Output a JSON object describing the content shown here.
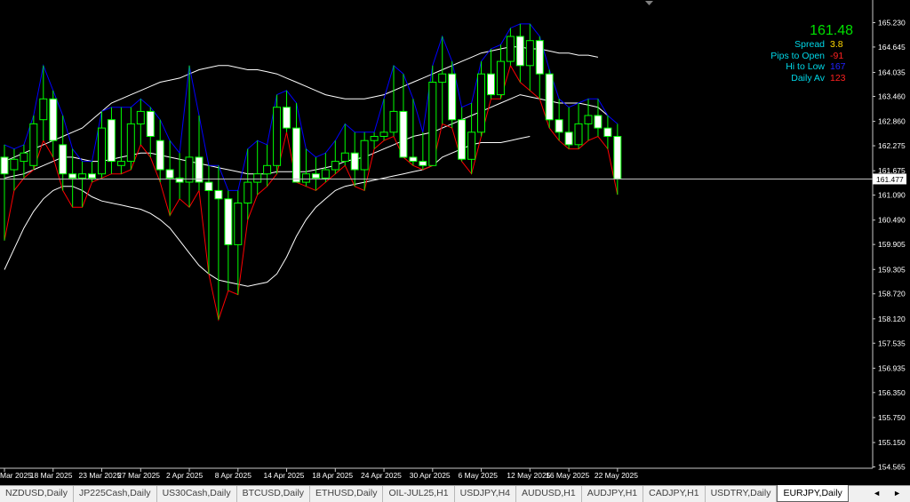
{
  "chart_data": {
    "type": "candlestick",
    "symbol": "EURJPY",
    "timeframe": "Daily",
    "price_axis": {
      "ticks": [
        "165.230",
        "164.645",
        "164.035",
        "163.460",
        "162.860",
        "162.275",
        "161.675",
        "161.090",
        "160.490",
        "159.905",
        "159.305",
        "158.720",
        "158.120",
        "157.535",
        "156.935",
        "156.350",
        "155.750",
        "155.150",
        "154.565"
      ],
      "range": [
        154.3,
        165.6
      ]
    },
    "current_price_label": "161.477",
    "current_price": 161.477,
    "date_labels": [
      "Mar 2025",
      "18 Mar 2025",
      "23 Mar 2025",
      "27 Mar 2025",
      "2 Apr 2025",
      "8 Apr 2025",
      "14 Apr 2025",
      "18 Apr 2025",
      "24 Apr 2025",
      "30 Apr 2025",
      "6 May 2025",
      "12 May 2025",
      "16 May 2025",
      "22 May 2025"
    ],
    "candles": [
      [
        162.0,
        162.3,
        160.0,
        161.6
      ],
      [
        161.7,
        162.2,
        161.2,
        161.95
      ],
      [
        161.9,
        162.3,
        161.5,
        162.1
      ],
      [
        161.8,
        163.0,
        161.7,
        162.8
      ],
      [
        162.9,
        164.2,
        162.4,
        163.4
      ],
      [
        163.4,
        163.6,
        162.0,
        162.4
      ],
      [
        162.3,
        163.0,
        161.2,
        161.6
      ],
      [
        161.6,
        162.2,
        160.8,
        161.5
      ],
      [
        161.5,
        161.9,
        160.8,
        161.6
      ],
      [
        161.6,
        161.9,
        161.4,
        161.5
      ],
      [
        161.6,
        163.1,
        161.5,
        162.7
      ],
      [
        162.9,
        163.2,
        161.6,
        161.9
      ],
      [
        161.8,
        163.2,
        161.6,
        161.9
      ],
      [
        161.9,
        163.2,
        161.7,
        162.8
      ],
      [
        162.8,
        163.4,
        162.3,
        163.1
      ],
      [
        163.1,
        163.2,
        162.0,
        162.5
      ],
      [
        162.4,
        162.9,
        161.4,
        161.7
      ],
      [
        161.7,
        162.4,
        160.6,
        161.5
      ],
      [
        161.5,
        162.1,
        161.0,
        161.4
      ],
      [
        161.4,
        164.2,
        160.8,
        162.0
      ],
      [
        162.0,
        163.0,
        161.2,
        161.4
      ],
      [
        161.4,
        161.8,
        159.2,
        161.2
      ],
      [
        161.2,
        161.8,
        158.1,
        161.0
      ],
      [
        161.0,
        161.2,
        158.8,
        159.9
      ],
      [
        159.9,
        161.2,
        158.7,
        160.9
      ],
      [
        160.9,
        162.2,
        160.5,
        161.4
      ],
      [
        161.4,
        162.4,
        161.1,
        161.6
      ],
      [
        161.6,
        162.3,
        161.3,
        161.8
      ],
      [
        161.8,
        163.5,
        161.6,
        163.2
      ],
      [
        163.2,
        163.6,
        162.6,
        162.7
      ],
      [
        162.7,
        163.3,
        161.4,
        161.4
      ],
      [
        161.4,
        162.2,
        161.3,
        161.6
      ],
      [
        161.6,
        162.0,
        161.2,
        161.5
      ],
      [
        161.5,
        162.1,
        161.4,
        161.7
      ],
      [
        161.7,
        162.4,
        161.6,
        161.9
      ],
      [
        161.9,
        162.8,
        161.8,
        162.1
      ],
      [
        162.1,
        162.6,
        161.3,
        161.7
      ],
      [
        161.7,
        162.6,
        161.2,
        162.4
      ],
      [
        162.4,
        162.6,
        162.2,
        162.5
      ],
      [
        162.5,
        163.4,
        162.4,
        162.6
      ],
      [
        162.6,
        164.2,
        162.5,
        163.1
      ],
      [
        163.1,
        164.0,
        162.0,
        162.0
      ],
      [
        162.0,
        163.4,
        161.8,
        161.9
      ],
      [
        161.9,
        162.6,
        161.7,
        161.8
      ],
      [
        161.8,
        164.2,
        161.8,
        163.8
      ],
      [
        163.8,
        164.9,
        162.8,
        164.0
      ],
      [
        164.0,
        164.3,
        162.7,
        162.9
      ],
      [
        162.9,
        163.2,
        161.9,
        161.95
      ],
      [
        161.95,
        163.3,
        161.6,
        162.6
      ],
      [
        162.6,
        164.3,
        162.5,
        164.0
      ],
      [
        164.0,
        164.6,
        163.4,
        163.5
      ],
      [
        163.5,
        164.7,
        163.4,
        164.3
      ],
      [
        164.3,
        165.1,
        164.2,
        164.9
      ],
      [
        164.9,
        165.2,
        163.8,
        164.2
      ],
      [
        164.2,
        165.2,
        163.6,
        164.8
      ],
      [
        164.8,
        164.9,
        163.4,
        164.0
      ],
      [
        164.0,
        164.1,
        162.7,
        162.9
      ],
      [
        162.9,
        163.4,
        162.4,
        162.6
      ],
      [
        162.6,
        163.2,
        162.2,
        162.3
      ],
      [
        162.3,
        163.3,
        162.2,
        162.8
      ],
      [
        162.8,
        163.4,
        162.4,
        163.0
      ],
      [
        163.0,
        163.4,
        162.5,
        162.7
      ],
      [
        162.7,
        163.0,
        162.2,
        162.5
      ],
      [
        162.5,
        162.8,
        161.1,
        161.48
      ]
    ],
    "bands": {
      "upper": [
        161.9,
        162.0,
        162.1,
        162.2,
        162.3,
        162.4,
        162.5,
        162.6,
        162.7,
        162.9,
        163.1,
        163.3,
        163.4,
        163.5,
        163.6,
        163.7,
        163.8,
        163.85,
        163.9,
        164.0,
        164.1,
        164.15,
        164.2,
        164.2,
        164.15,
        164.1,
        164.1,
        164.05,
        164.0,
        163.9,
        163.8,
        163.7,
        163.6,
        163.5,
        163.45,
        163.4,
        163.4,
        163.4,
        163.45,
        163.5,
        163.6,
        163.7,
        163.8,
        163.9,
        164.0,
        164.1,
        164.2,
        164.3,
        164.4,
        164.5,
        164.55,
        164.6,
        164.65,
        164.65,
        164.6,
        164.6,
        164.55,
        164.5,
        164.5,
        164.45,
        164.45,
        164.4
      ],
      "middle": [
        161.5,
        161.55,
        161.6,
        161.7,
        161.8,
        161.9,
        162.0,
        162.0,
        161.95,
        161.9,
        161.9,
        161.95,
        162.0,
        162.05,
        162.1,
        162.1,
        162.05,
        162.0,
        161.95,
        161.9,
        161.85,
        161.8,
        161.75,
        161.7,
        161.65,
        161.6,
        161.6,
        161.6,
        161.65,
        161.65,
        161.65,
        161.65,
        161.7,
        161.75,
        161.8,
        161.9,
        161.95,
        162.0,
        162.1,
        162.2,
        162.3,
        162.4,
        162.5,
        162.55,
        162.6,
        162.7,
        162.8,
        162.9,
        163.0,
        163.1,
        163.2,
        163.3,
        163.4,
        163.5,
        163.45,
        163.4,
        163.35,
        163.3,
        163.3,
        163.3,
        163.25,
        163.2,
        163.0
      ],
      "lower": [
        159.3,
        159.8,
        160.3,
        160.7,
        161.0,
        161.2,
        161.3,
        161.3,
        161.2,
        161.05,
        160.95,
        160.9,
        160.85,
        160.8,
        160.75,
        160.65,
        160.5,
        160.3,
        160.0,
        159.7,
        159.4,
        159.2,
        159.05,
        159.0,
        158.95,
        158.9,
        158.95,
        159.0,
        159.2,
        159.6,
        160.1,
        160.5,
        160.8,
        161.0,
        161.2,
        161.3,
        161.35,
        161.4,
        161.45,
        161.5,
        161.55,
        161.6,
        161.65,
        161.7,
        161.8,
        162.0,
        162.1,
        162.2,
        162.3,
        162.35,
        162.35,
        162.35,
        162.4,
        162.45,
        162.5
      ]
    }
  },
  "info_panel": {
    "price": "161.48",
    "rows": [
      {
        "label": "Spread",
        "value": "3.8",
        "color": "#ffd700"
      },
      {
        "label": "Pips to Open",
        "value": "-91",
        "color": "#ff2020"
      },
      {
        "label": "Hi to Low",
        "value": "167",
        "color": "#2020ff"
      },
      {
        "label": "Daily Av",
        "value": "123",
        "color": "#ff2020"
      }
    ]
  },
  "colors": {
    "bull_body": "#000000",
    "bear_body": "#ffffff",
    "wick": "#00ff00",
    "bands": "#ffffff",
    "high_line": "#0000ff",
    "low_line": "#ff0000",
    "bid_line": "#c0c0c0"
  },
  "tabs": [
    {
      "label": "NZDUSD,Daily",
      "active": false
    },
    {
      "label": "JP225Cash,Daily",
      "active": false
    },
    {
      "label": "US30Cash,Daily",
      "active": false
    },
    {
      "label": "BTCUSD,Daily",
      "active": false
    },
    {
      "label": "ETHUSD,Daily",
      "active": false
    },
    {
      "label": "OIL-JUL25,H1",
      "active": false
    },
    {
      "label": "USDJPY,H4",
      "active": false
    },
    {
      "label": "AUDUSD,H1",
      "active": false
    },
    {
      "label": "AUDJPY,H1",
      "active": false
    },
    {
      "label": "CADJPY,H1",
      "active": false
    },
    {
      "label": "USDTRY,Daily",
      "active": false
    },
    {
      "label": "EURJPY,Daily",
      "active": true
    }
  ],
  "tab_scroll": {
    "left": "◄",
    "right": "►"
  }
}
